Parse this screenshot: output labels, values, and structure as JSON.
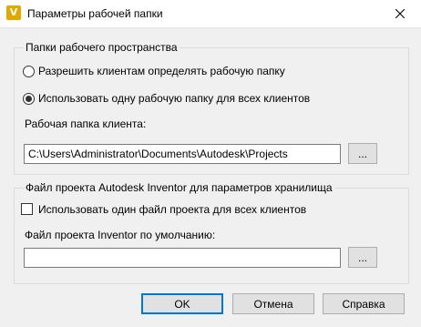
{
  "window": {
    "title": "Параметры рабочей папки",
    "app_icon_letter": "V",
    "close_glyph": "✕"
  },
  "workspace_group": {
    "title": "Папки рабочего пространства",
    "radio_allow_label": "Разрешить клиентам определять рабочую папку",
    "radio_single_label": "Использовать одну рабочую папку для всех клиентов",
    "selected_radio": "single",
    "client_folder_label": "Рабочая папка клиента:",
    "client_folder_value": "C:\\Users\\Administrator\\Documents\\Autodesk\\Projects",
    "browse_label": "..."
  },
  "project_group": {
    "title": "Файл проекта Autodesk Inventor для параметров хранилища",
    "checkbox_label": "Использовать один файл проекта для всех клиентов",
    "checkbox_checked": false,
    "default_project_label": "Файл проекта Inventor по умолчанию:",
    "default_project_value": "",
    "browse_label": "..."
  },
  "footer": {
    "ok_label": "OK",
    "cancel_label": "Отмена",
    "help_label": "Справка"
  }
}
